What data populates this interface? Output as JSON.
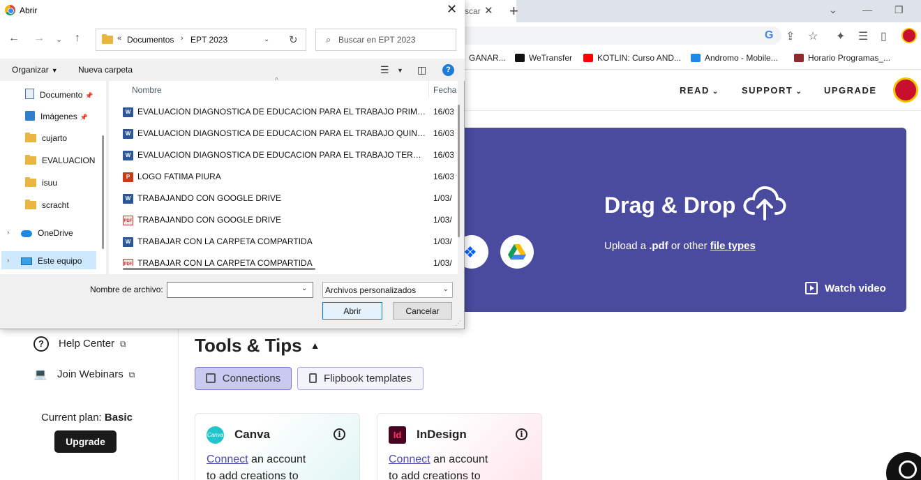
{
  "browser": {
    "tab_partial_text": "scar",
    "bookmarks": [
      {
        "label": "GANAR...",
        "color": "#777777"
      },
      {
        "label": "WeTransfer",
        "color": "#111111"
      },
      {
        "label": "KOTLIN: Curso AND...",
        "color": "#ff0000"
      },
      {
        "label": "Andromo - Mobile...",
        "color": "#1e88e5"
      },
      {
        "label": "Horario Programas_...",
        "color": "#8b2b2b"
      }
    ]
  },
  "site": {
    "nav": [
      "READ",
      "SUPPORT",
      "UPGRADE"
    ],
    "upload": {
      "title": "Drag & Drop",
      "subtitle_prefix": "Upload a",
      "subtitle_bold": ".pdf",
      "subtitle_mid": "or other",
      "subtitle_link": "file types",
      "watch_video": "Watch video"
    },
    "sidebar": {
      "help_center": "Help Center",
      "join_webinars": "Join Webinars",
      "plan_label": "Current plan:",
      "plan_value": "Basic",
      "upgrade": "Upgrade"
    },
    "tools": {
      "title": "Tools & Tips",
      "chips": [
        "Connections",
        "Flipbook templates"
      ],
      "cards": [
        {
          "title": "Canva",
          "link": "Connect",
          "text_1": "an account",
          "text_2": "to add creations to",
          "logo_text": "Canva",
          "logo_color": "#20c4cb"
        },
        {
          "title": "InDesign",
          "link": "Connect",
          "text_1": "an account",
          "text_2": "to add creations to",
          "logo_text": "Id",
          "logo_color": "#49021f"
        }
      ]
    }
  },
  "dialog": {
    "title": "Abrir",
    "path": {
      "overflow": "«",
      "segments": [
        "Documentos",
        "EPT 2023"
      ]
    },
    "search_placeholder": "Buscar en EPT 2023",
    "toolbar": {
      "organize": "Organizar",
      "new_folder": "Nueva carpeta"
    },
    "nav_items": [
      {
        "label": "Documento",
        "icon": "doc",
        "pinned": true
      },
      {
        "label": "Imágenes",
        "icon": "image",
        "pinned": true
      },
      {
        "label": "cujarto",
        "icon": "folder",
        "pinned": false
      },
      {
        "label": "EVALUACION",
        "icon": "folder",
        "pinned": false
      },
      {
        "label": "isuu",
        "icon": "folder",
        "pinned": false
      },
      {
        "label": "scracht",
        "icon": "folder",
        "pinned": false
      },
      {
        "label": "OneDrive",
        "icon": "cloud",
        "pinned": false
      },
      {
        "label": "Este equipo",
        "icon": "pc",
        "pinned": false
      }
    ],
    "columns": {
      "name": "Nombre",
      "date": "Fecha"
    },
    "files": [
      {
        "name": "EVALUACION DIAGNOSTICA DE EDUCACION PARA EL TRABAJO PRIMERO Y...",
        "date": "16/03",
        "type": "word"
      },
      {
        "name": "EVALUACION DIAGNOSTICA DE EDUCACION PARA EL TRABAJO QUINTO",
        "date": "16/03",
        "type": "word"
      },
      {
        "name": "EVALUACION DIAGNOSTICA DE EDUCACION PARA EL TRABAJO TERCERO Y...",
        "date": "16/03",
        "type": "word"
      },
      {
        "name": "LOGO FATIMA PIURA",
        "date": "16/03",
        "type": "ppt"
      },
      {
        "name": "TRABAJANDO CON GOOGLE DRIVE",
        "date": "1/03/",
        "type": "word"
      },
      {
        "name": "TRABAJANDO CON GOOGLE DRIVE",
        "date": "1/03/",
        "type": "pdf"
      },
      {
        "name": "TRABAJAR CON LA CARPETA COMPARTIDA",
        "date": "1/03/",
        "type": "word"
      },
      {
        "name": "TRABAJAR CON LA CARPETA COMPARTIDA",
        "date": "1/03/",
        "type": "pdf"
      }
    ],
    "filename_label": "Nombre de archivo:",
    "filename_value": "",
    "filetype": "Archivos personalizados",
    "open": "Abrir",
    "cancel": "Cancelar"
  }
}
